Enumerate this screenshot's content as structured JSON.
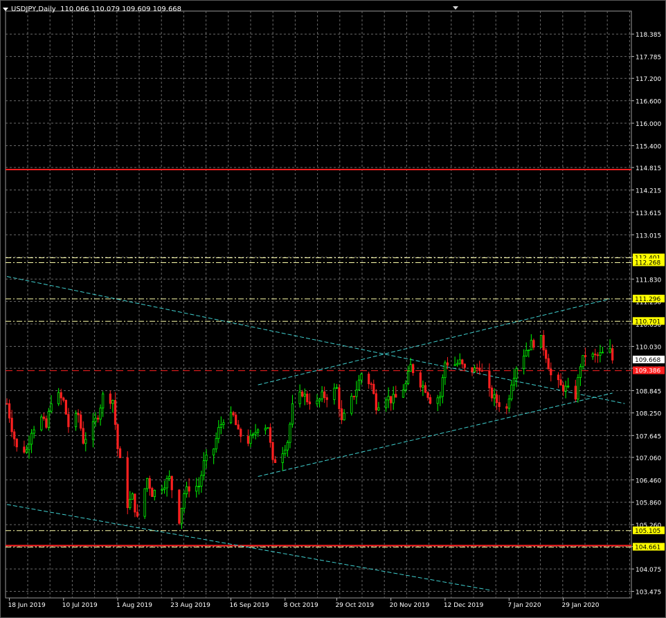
{
  "header": {
    "symbol": "USDJPY,Daily",
    "ohlc": "110.066 110.079 109.609 109.668"
  },
  "chart_data": {
    "type": "candlestick",
    "symbol": "USDJPY",
    "timeframe": "Daily",
    "ylim": [
      103.3,
      119.0
    ],
    "price_ticks": [
      "118.385",
      "117.785",
      "117.200",
      "116.600",
      "116.000",
      "115.400",
      "114.815",
      "114.215",
      "113.615",
      "113.015",
      "112.415",
      "111.830",
      "111.230",
      "110.630",
      "110.030",
      "109.445",
      "108.845",
      "108.250",
      "107.645",
      "107.060",
      "106.460",
      "105.860",
      "105.260",
      "104.675",
      "104.075",
      "103.475"
    ],
    "date_ticks": [
      "18 Jun 2019",
      "10 Jul 2019",
      "1 Aug 2019",
      "23 Aug 2019",
      "16 Sep 2019",
      "8 Oct 2019",
      "29 Oct 2019",
      "20 Nov 2019",
      "12 Dec 2019",
      "7 Jan 2020",
      "29 Jan 2020"
    ],
    "price_labels": [
      {
        "text": "112.401",
        "value": 112.4,
        "bg": "#ffff00",
        "fg": "#000000"
      },
      {
        "text": "112.268",
        "value": 112.27,
        "bg": "#ffff00",
        "fg": "#000000"
      },
      {
        "text": "111.296",
        "value": 111.3,
        "bg": "#ffff00",
        "fg": "#000000"
      },
      {
        "text": "110.701",
        "value": 110.7,
        "bg": "#ffff00",
        "fg": "#000000"
      },
      {
        "text": "109.668",
        "value": 109.67,
        "bg": "#ffffff",
        "fg": "#000000"
      },
      {
        "text": "109.386",
        "value": 109.38,
        "bg": "#ff2020",
        "fg": "#ffffff"
      },
      {
        "text": "105.105",
        "value": 105.1,
        "bg": "#ffff00",
        "fg": "#000000"
      },
      {
        "text": "104.661",
        "value": 104.66,
        "bg": "#ffff00",
        "fg": "#000000"
      }
    ],
    "hlines": [
      {
        "value": 114.76,
        "color": "#ff2020",
        "style": "solid"
      },
      {
        "value": 112.4,
        "color": "#ffffaa",
        "style": "dash"
      },
      {
        "value": 112.27,
        "color": "#ffffaa",
        "style": "dash"
      },
      {
        "value": 111.3,
        "color": "#ffffaa",
        "style": "dash"
      },
      {
        "value": 110.7,
        "color": "#ffffaa",
        "style": "dash"
      },
      {
        "value": 109.38,
        "color": "#ff2020",
        "style": "dash"
      },
      {
        "value": 105.1,
        "color": "#ffffaa",
        "style": "dash"
      },
      {
        "value": 104.7,
        "color": "#ff2020",
        "style": "solid"
      },
      {
        "value": 104.66,
        "color": "#ffffaa",
        "style": "dash"
      }
    ],
    "trendlines": [
      {
        "from": [
          "2019-06-17",
          111.9
        ],
        "to": [
          "2020-02-23",
          108.5
        ],
        "color": "#40d0d0"
      },
      {
        "from": [
          "2019-09-27",
          106.55
        ],
        "to": [
          "2020-02-18",
          108.78
        ],
        "color": "#40d0d0"
      },
      {
        "from": [
          "2019-09-27",
          109.0
        ],
        "to": [
          "2020-02-17",
          111.3
        ],
        "color": "#40d0d0"
      },
      {
        "from": [
          "2019-06-17",
          105.8
        ],
        "to": [
          "2019-12-31",
          103.5
        ],
        "color": "#40d0d0"
      }
    ],
    "closes": [
      [
        "2019-06-17",
        108.5
      ],
      [
        "2019-06-19",
        107.85
      ],
      [
        "2019-06-21",
        107.3
      ],
      [
        "2019-06-25",
        107.25
      ],
      [
        "2019-06-27",
        107.8
      ],
      [
        "2019-07-01",
        108.1
      ],
      [
        "2019-07-03",
        107.85
      ],
      [
        "2019-07-05",
        108.6
      ],
      [
        "2019-07-08",
        108.7
      ],
      [
        "2019-07-10",
        108.55
      ],
      [
        "2019-07-12",
        107.9
      ],
      [
        "2019-07-16",
        108.2
      ],
      [
        "2019-07-18",
        107.5
      ],
      [
        "2019-07-22",
        107.9
      ],
      [
        "2019-07-24",
        108.2
      ],
      [
        "2019-07-26",
        108.7
      ],
      [
        "2019-07-30",
        108.6
      ],
      [
        "2019-08-01",
        107.3
      ],
      [
        "2019-08-03",
        106.6
      ],
      [
        "2019-08-05",
        105.8
      ],
      [
        "2019-08-07",
        106.0
      ],
      [
        "2019-08-09",
        105.4
      ],
      [
        "2019-08-13",
        106.5
      ],
      [
        "2019-08-15",
        106.1
      ],
      [
        "2019-08-19",
        106.3
      ],
      [
        "2019-08-22",
        106.5
      ],
      [
        "2019-08-26",
        105.4
      ],
      [
        "2019-08-28",
        106.1
      ],
      [
        "2019-08-30",
        106.25
      ],
      [
        "2019-09-03",
        106.3
      ],
      [
        "2019-09-05",
        106.9
      ],
      [
        "2019-09-09",
        107.3
      ],
      [
        "2019-09-11",
        107.8
      ],
      [
        "2019-09-13",
        108.1
      ],
      [
        "2019-09-17",
        108.15
      ],
      [
        "2019-09-19",
        107.7
      ],
      [
        "2019-09-23",
        107.5
      ],
      [
        "2019-09-25",
        107.6
      ],
      [
        "2019-09-27",
        107.9
      ],
      [
        "2019-10-01",
        107.9
      ],
      [
        "2019-10-03",
        106.9
      ],
      [
        "2019-10-07",
        107.25
      ],
      [
        "2019-10-09",
        107.5
      ],
      [
        "2019-10-11",
        108.4
      ],
      [
        "2019-10-15",
        108.8
      ],
      [
        "2019-10-17",
        108.6
      ],
      [
        "2019-10-21",
        108.5
      ],
      [
        "2019-10-23",
        108.7
      ],
      [
        "2019-10-25",
        108.7
      ],
      [
        "2019-10-29",
        108.9
      ],
      [
        "2019-10-31",
        108.0
      ],
      [
        "2019-11-04",
        108.6
      ],
      [
        "2019-11-06",
        108.9
      ],
      [
        "2019-11-08",
        109.3
      ],
      [
        "2019-11-12",
        109.0
      ],
      [
        "2019-11-14",
        108.45
      ],
      [
        "2019-11-18",
        108.7
      ],
      [
        "2019-11-20",
        108.6
      ],
      [
        "2019-11-22",
        108.65
      ],
      [
        "2019-11-26",
        109.0
      ],
      [
        "2019-11-28",
        109.5
      ],
      [
        "2019-12-02",
        109.05
      ],
      [
        "2019-12-04",
        108.9
      ],
      [
        "2019-12-06",
        108.6
      ],
      [
        "2019-12-10",
        108.7
      ],
      [
        "2019-12-12",
        109.6
      ],
      [
        "2019-12-16",
        109.55
      ],
      [
        "2019-12-18",
        109.6
      ],
      [
        "2019-12-20",
        109.4
      ],
      [
        "2019-12-24",
        109.4
      ],
      [
        "2019-12-26",
        109.5
      ],
      [
        "2019-12-30",
        108.8
      ],
      [
        "2020-01-02",
        108.55
      ],
      [
        "2020-01-06",
        108.35
      ],
      [
        "2020-01-08",
        109.1
      ],
      [
        "2020-01-10",
        109.5
      ],
      [
        "2020-01-14",
        109.95
      ],
      [
        "2020-01-16",
        110.1
      ],
      [
        "2020-01-20",
        110.2
      ],
      [
        "2020-01-22",
        109.8
      ],
      [
        "2020-01-24",
        109.25
      ],
      [
        "2020-01-28",
        108.95
      ],
      [
        "2020-01-30",
        108.9
      ],
      [
        "2020-02-03",
        108.7
      ],
      [
        "2020-02-05",
        109.55
      ],
      [
        "2020-02-07",
        109.8
      ],
      [
        "2020-02-11",
        109.75
      ],
      [
        "2020-02-13",
        109.8
      ],
      [
        "2020-02-17",
        109.9
      ],
      [
        "2020-02-18",
        109.67
      ]
    ]
  }
}
